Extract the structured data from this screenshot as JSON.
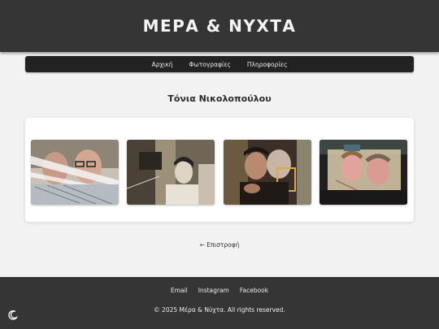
{
  "site": {
    "title": "ΜΕΡΑ & ΝΥΧΤΑ"
  },
  "nav": {
    "items": [
      "Αρχική",
      "Φωτογραφίες",
      "Πληροφορίες"
    ]
  },
  "page": {
    "title": "Τόνια Νικολοπούλου"
  },
  "gallery": {
    "photos": [
      {
        "name": "photo-two-men-glasses"
      },
      {
        "name": "photo-vintage-film-woman"
      },
      {
        "name": "photo-couple-kissing"
      },
      {
        "name": "photo-double-exposure-couple"
      }
    ]
  },
  "back_link": "← Επιστροφή",
  "footer": {
    "links": [
      "Email",
      "Instagram",
      "Facebook"
    ],
    "copyright": "© 2025 Μέρα & Νύχτα. All rights reserved."
  },
  "icons": {
    "theme_toggle": "moon-icon"
  },
  "colors": {
    "header_bg": "#353535",
    "nav_bg": "#222222",
    "page_bg": "#f2f2f2"
  }
}
